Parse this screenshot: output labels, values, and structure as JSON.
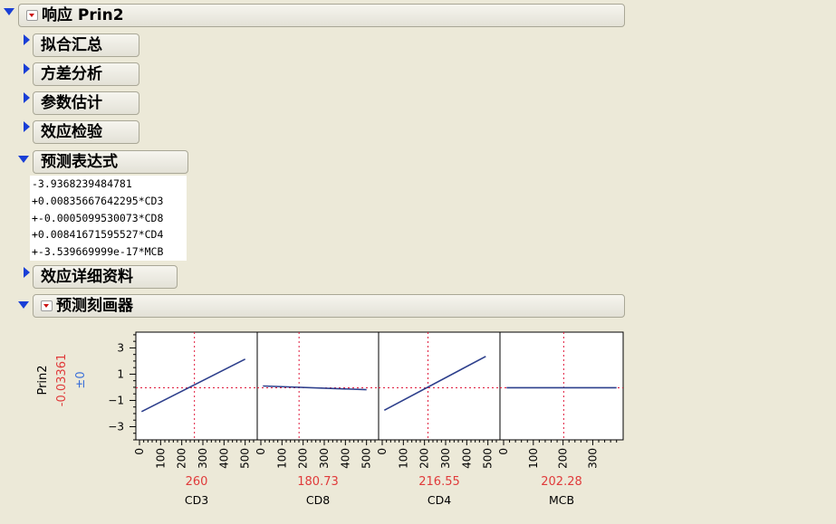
{
  "report": {
    "title": "响应 Prin2",
    "sections": {
      "fit_summary": "拟合汇总",
      "anova": "方差分析",
      "param_est": "参数估计",
      "effect_tests": "效应检验",
      "pred_expr": "预测表达式",
      "effect_details": "效应详细资料",
      "profiler": "预测刻画器"
    }
  },
  "prediction_expression": {
    "lines": [
      "-3.9368239484781",
      "+0.00835667642295*CD3",
      "+-0.0005099530073*CD8",
      "+0.00841671595527*CD4",
      "+-3.539669999e-17*MCB"
    ]
  },
  "profiler": {
    "response": {
      "name": "Prin2",
      "value": "-0.03361",
      "ci": "±0"
    },
    "y_ticks": [
      -3,
      -1,
      1,
      3
    ],
    "y_range": [
      -4,
      4.2
    ],
    "colors": {
      "trace": "#2d3f8c",
      "crosshair": "#e01a3c",
      "value_red": "#e03a3a",
      "ci_blue": "#3a6fd8"
    },
    "factors": [
      {
        "name": "CD3",
        "current": "260",
        "current_num": 260,
        "xlim": [
          0,
          540
        ],
        "ticks": [
          0,
          100,
          200,
          300,
          400,
          500
        ],
        "curve": [
          [
            10,
            -1.85
          ],
          [
            500,
            2.15
          ]
        ]
      },
      {
        "name": "CD8",
        "current": "180.73",
        "current_num": 180.73,
        "xlim": [
          0,
          540
        ],
        "ticks": [
          0,
          100,
          200,
          300,
          400,
          500
        ],
        "curve": [
          [
            10,
            0.1
          ],
          [
            500,
            -0.18
          ]
        ]
      },
      {
        "name": "CD4",
        "current": "216.55",
        "current_num": 216.55,
        "xlim": [
          0,
          540
        ],
        "ticks": [
          0,
          100,
          200,
          300,
          400,
          500
        ],
        "curve": [
          [
            10,
            -1.75
          ],
          [
            490,
            2.35
          ]
        ]
      },
      {
        "name": "MCB",
        "current": "202.28",
        "current_num": 202.28,
        "xlim": [
          0,
          390
        ],
        "ticks": [
          0,
          100,
          200,
          300
        ],
        "curve": [
          [
            10,
            -0.03
          ],
          [
            380,
            -0.03
          ]
        ]
      }
    ]
  }
}
